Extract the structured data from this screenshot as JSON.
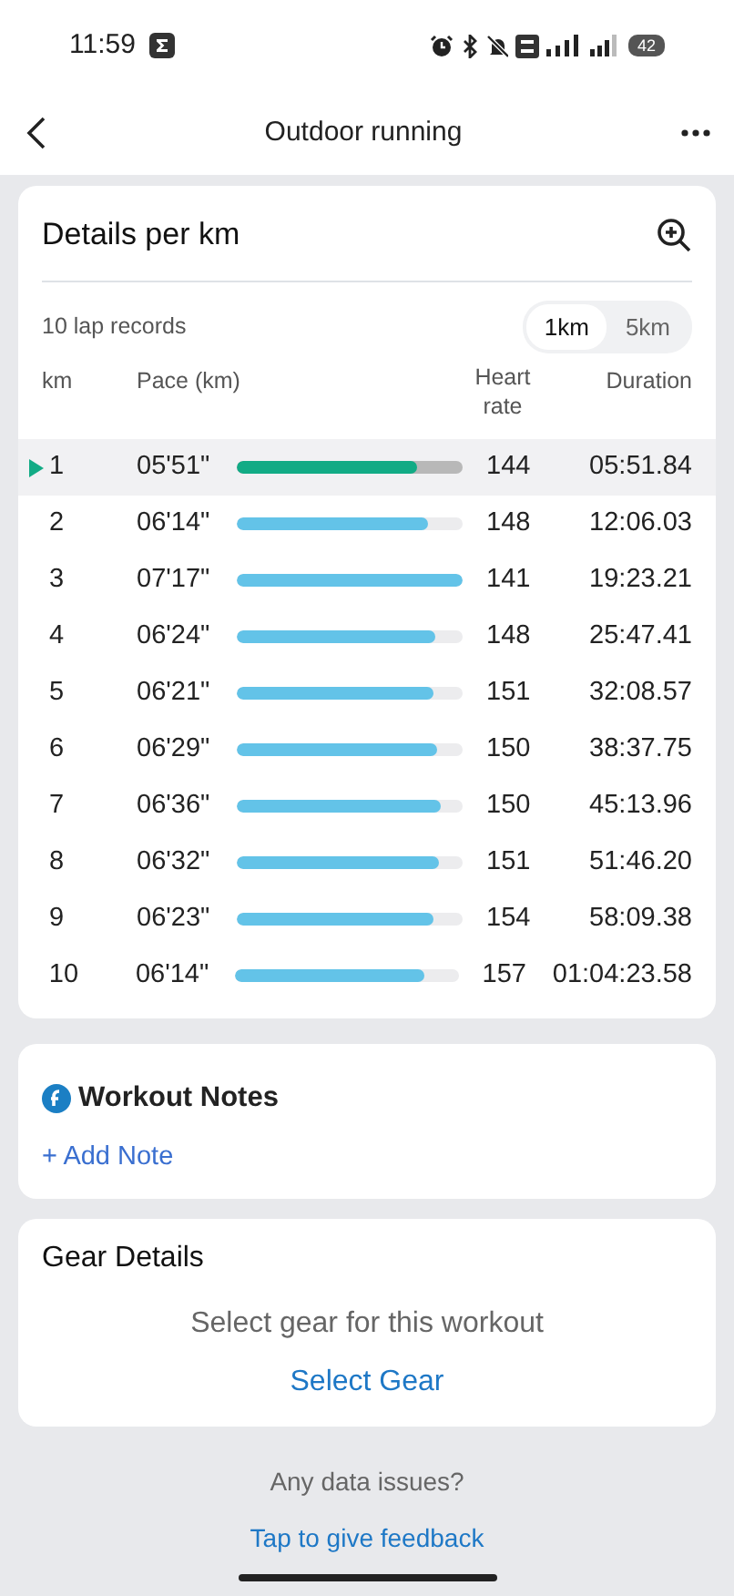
{
  "status_bar": {
    "time": "11:59",
    "battery": "42"
  },
  "header": {
    "title": "Outdoor running"
  },
  "laps_card": {
    "title": "Details per km",
    "count": "10 lap records",
    "units": [
      {
        "label": "1km",
        "selected": true
      },
      {
        "label": "5km",
        "selected": false
      }
    ],
    "columns": [
      "km",
      "Pace (km)",
      "Heart rate",
      "Duration"
    ],
    "rows": [
      {
        "km": "1",
        "pace": "05'51\"",
        "level": 0.8,
        "heart_rate": "144",
        "duration": "05:51.84",
        "selected": true
      },
      {
        "km": "2",
        "pace": "06'14\"",
        "level": 0.85,
        "heart_rate": "148",
        "duration": "12:06.03",
        "selected": false
      },
      {
        "km": "3",
        "pace": "07'17\"",
        "level": 1,
        "heart_rate": "141",
        "duration": "19:23.21",
        "selected": false
      },
      {
        "km": "4",
        "pace": "06'24\"",
        "level": 0.88,
        "heart_rate": "148",
        "duration": "25:47.41",
        "selected": false
      },
      {
        "km": "5",
        "pace": "06'21\"",
        "level": 0.87,
        "heart_rate": "151",
        "duration": "32:08.57",
        "selected": false
      },
      {
        "km": "6",
        "pace": "06'29\"",
        "level": 0.89,
        "heart_rate": "150",
        "duration": "38:37.75",
        "selected": false
      },
      {
        "km": "7",
        "pace": "06'36\"",
        "level": 0.9,
        "heart_rate": "150",
        "duration": "45:13.96",
        "selected": false
      },
      {
        "km": "8",
        "pace": "06'32\"",
        "level": 0.895,
        "heart_rate": "151",
        "duration": "51:46.20",
        "selected": false
      },
      {
        "km": "9",
        "pace": "06'23\"",
        "level": 0.87,
        "heart_rate": "154",
        "duration": "58:09.38",
        "selected": false
      },
      {
        "km": "10",
        "pace": "06'14\"",
        "level": 0.85,
        "heart_rate": "157",
        "duration": "01:04:23.58",
        "selected": false
      }
    ]
  },
  "notes_card": {
    "title": "Workout Notes",
    "action": "+ Add Note"
  },
  "gear_card": {
    "title": "Gear Details",
    "prompt": "Select gear for this workout",
    "action": "Select Gear"
  },
  "footer": {
    "question": "Any data issues?",
    "link": "Tap to give feedback"
  }
}
